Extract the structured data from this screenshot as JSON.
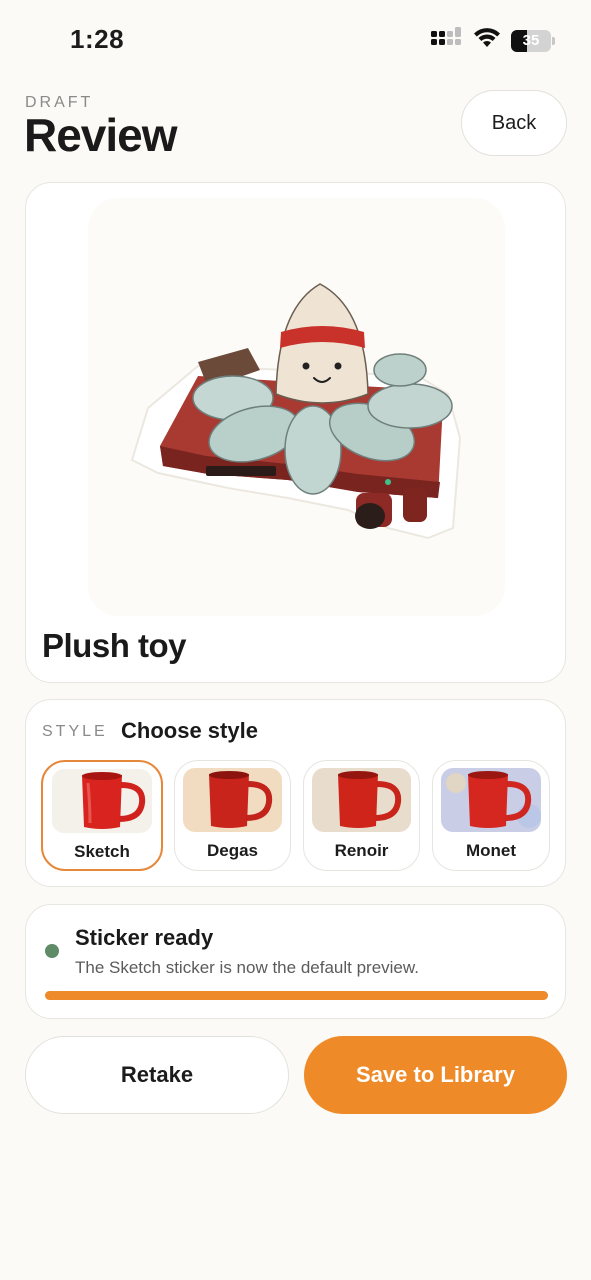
{
  "status_bar": {
    "time": "1:28",
    "battery": "35",
    "icons": [
      "cellular-signal-icon",
      "wifi-icon",
      "battery-icon"
    ]
  },
  "header": {
    "eyebrow": "DRAFT",
    "title": "Review",
    "back_label": "Back"
  },
  "preview": {
    "title": "Plush toy",
    "image": "plush-toy-sticker-image"
  },
  "style": {
    "eyebrow": "STYLE",
    "heading": "Choose style",
    "options": [
      {
        "label": "Sketch",
        "selected": true
      },
      {
        "label": "Degas",
        "selected": false
      },
      {
        "label": "Renoir",
        "selected": false
      },
      {
        "label": "Monet",
        "selected": false
      }
    ]
  },
  "status": {
    "title": "Sticker ready",
    "description": "The Sketch sticker is now the default preview.",
    "progress": 1.0
  },
  "actions": {
    "retake_label": "Retake",
    "save_label": "Save to Library"
  },
  "colors": {
    "accent": "#ef8a28",
    "selected_border": "#e6883a",
    "status_dot": "#5f8b66",
    "background": "#fbfaf6"
  }
}
